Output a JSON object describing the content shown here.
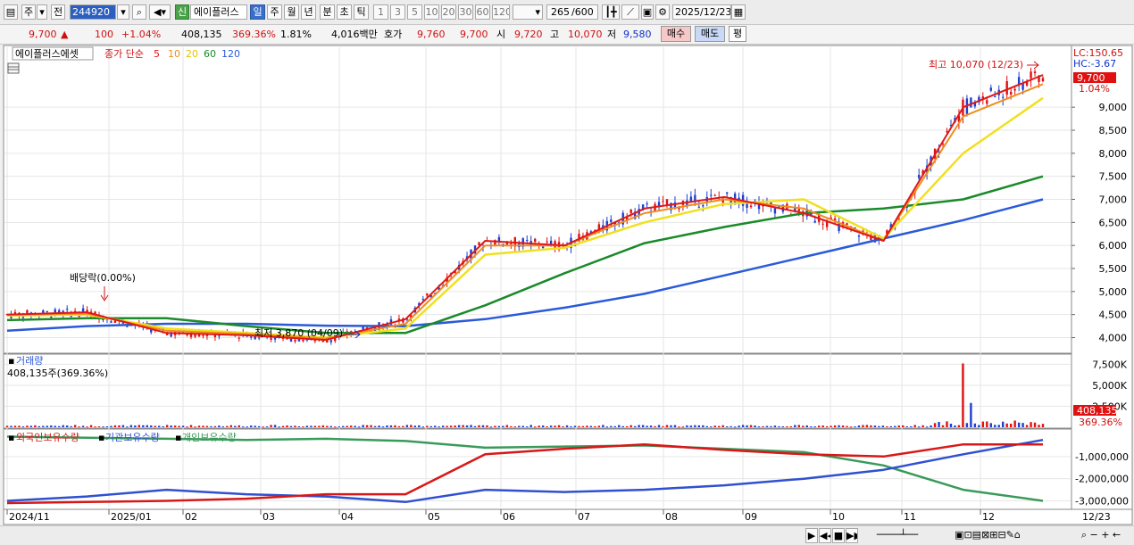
{
  "toolbar": {
    "market": "주",
    "prev": "전",
    "code": "244920",
    "stock_name": "에이플러스",
    "new_badge": "신",
    "periods": [
      "일",
      "주",
      "월",
      "년",
      "분",
      "초",
      "틱"
    ],
    "active_period": "일",
    "intervals": [
      "1",
      "3",
      "5",
      "10",
      "20",
      "30",
      "60",
      "120"
    ],
    "count": "265",
    "count_max": "/600",
    "date": "2025/12/23"
  },
  "quote": {
    "price": "9,700",
    "change": "100",
    "pct": "+1.04%",
    "volume": "408,135",
    "vol_ratio": "369.36%",
    "turnover": "1.81%",
    "amount": "4,016백만",
    "bid_label": "호가",
    "bid": "9,760",
    "ask": "9,700",
    "open_label": "시",
    "open": "9,720",
    "high_label": "고",
    "high": "10,070",
    "low_label": "저",
    "low": "9,580",
    "buy_btn": "매수",
    "sell_btn": "매도",
    "eval_btn": "평"
  },
  "legend": {
    "name": "에이플러스에셋",
    "ma_label": "종가 단순",
    "ma_periods": [
      "5",
      "10",
      "20",
      "60",
      "120"
    ],
    "ma_colors": [
      "#e01818",
      "#f08c1c",
      "#f0e020",
      "#1a8a2a",
      "#2a5ad8"
    ]
  },
  "price_panel": {
    "lc": "LC:150.65",
    "hc": "HC:-3.67",
    "cur_price": "9,700",
    "cur_pct": "1.04%",
    "y_ticks": [
      "9,000",
      "8,500",
      "8,000",
      "7,500",
      "7,000",
      "6,500",
      "6,000",
      "5,500",
      "5,000",
      "4,500",
      "4,000"
    ],
    "high_note": "최고 10,070 (12/23)",
    "low_note": "최저 3,870 (04/09)",
    "dividend_note": "배당락(0.00%)"
  },
  "volume_panel": {
    "title": "거래량",
    "info": "408,135주(369.36%)",
    "y_ticks": [
      "7,500K",
      "5,000K",
      "2,500K"
    ],
    "cur_vol": "408,135",
    "cur_pct": "369.36%"
  },
  "holdings_panel": {
    "labels": [
      "외국인보유수량",
      "기관보유수량",
      "개인보유수량"
    ],
    "colors": [
      "#d81818",
      "#3050d0",
      "#3a9a5a"
    ],
    "y_ticks": [
      "-1,000,000",
      "-2,000,000",
      "-3,000,000"
    ]
  },
  "x_axis": {
    "labels": [
      "2024/11",
      "2025/01",
      "02",
      "03",
      "04",
      "05",
      "06",
      "07",
      "08",
      "09",
      "10",
      "11",
      "12"
    ],
    "end_label": "12/23"
  },
  "chart_data": {
    "type": "line",
    "x": [
      "2024/11",
      "2025/01",
      "02",
      "03",
      "04",
      "05",
      "06",
      "07",
      "08",
      "09",
      "10",
      "11",
      "12",
      "12/23"
    ],
    "series": [
      {
        "name": "5",
        "values": [
          4500,
          4550,
          4100,
          4050,
          3950,
          4400,
          6100,
          6000,
          6800,
          7050,
          6700,
          6100,
          9000,
          9700
        ]
      },
      {
        "name": "10",
        "values": [
          4500,
          4520,
          4150,
          4080,
          3980,
          4300,
          6000,
          6000,
          6700,
          7000,
          6800,
          6100,
          8800,
          9500
        ]
      },
      {
        "name": "20",
        "values": [
          4480,
          4500,
          4200,
          4100,
          4000,
          4200,
          5800,
          5950,
          6500,
          6900,
          7000,
          6150,
          8000,
          9200
        ]
      },
      {
        "name": "60",
        "values": [
          4380,
          4420,
          4420,
          4250,
          4100,
          4100,
          4700,
          5400,
          6050,
          6400,
          6700,
          6800,
          7000,
          7500
        ]
      },
      {
        "name": "120",
        "values": [
          4150,
          4250,
          4300,
          4300,
          4260,
          4250,
          4400,
          4650,
          4950,
          5350,
          5750,
          6150,
          6550,
          7000
        ]
      }
    ],
    "ylim": [
      3700,
      10300
    ]
  }
}
